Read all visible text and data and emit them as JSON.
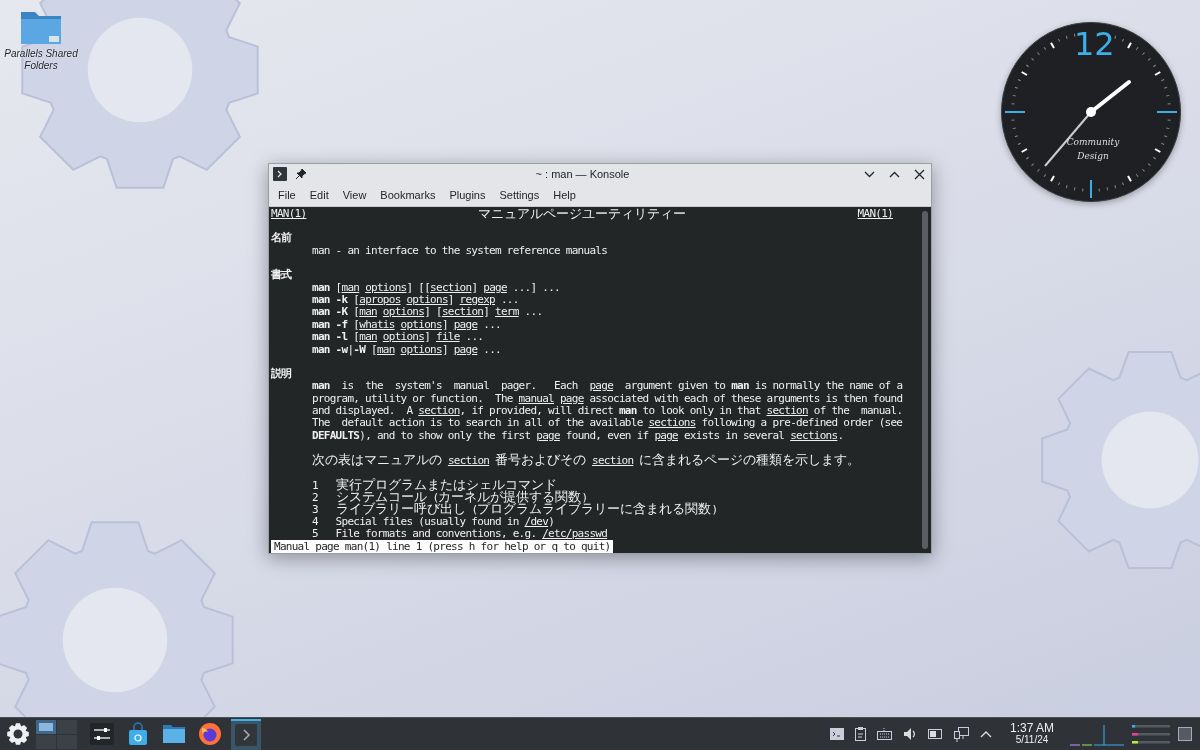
{
  "desktop": {
    "icons": [
      {
        "label": "Parallels Shared Folders"
      }
    ],
    "clock_widget": {
      "numeral": "12",
      "brand_lines": [
        "Community",
        "Design"
      ]
    }
  },
  "window": {
    "title": "~ : man — Konsole",
    "menu": [
      "File",
      "Edit",
      "View",
      "Bookmarks",
      "Plugins",
      "Settings",
      "Help"
    ]
  },
  "terminal": {
    "header": {
      "left": "MAN(1)",
      "center": "マニュアルページユーティリティー",
      "right": "MAN(1)"
    },
    "sections": [
      {
        "heading": "名前",
        "blocks": [
          [
            [
              {
                "text": "man - an interface to the system reference manuals",
                "bold": false,
                "underlined": false
              }
            ]
          ]
        ]
      },
      {
        "heading": "書式",
        "blocks": [
          [
            [
              {
                "text": "man",
                "bold": true,
                "underlined": false
              },
              {
                "text": " [",
                "bold": false,
                "underlined": false
              },
              {
                "text": "man",
                "bold": false,
                "underlined": true
              },
              {
                "text": " options",
                "bold": false,
                "underlined": true
              },
              {
                "text": "] [[",
                "bold": false,
                "underlined": false
              },
              {
                "text": "section",
                "bold": false,
                "underlined": true
              },
              {
                "text": "] ",
                "bold": false,
                "underlined": false
              },
              {
                "text": "page",
                "bold": false,
                "underlined": true
              },
              {
                "text": " ...] ...",
                "bold": false,
                "underlined": false
              }
            ],
            [
              {
                "text": "man -k",
                "bold": true,
                "underlined": false
              },
              {
                "text": " [",
                "bold": false,
                "underlined": false
              },
              {
                "text": "apropos",
                "bold": false,
                "underlined": true
              },
              {
                "text": " options",
                "bold": false,
                "underlined": true
              },
              {
                "text": "] ",
                "bold": false,
                "underlined": false
              },
              {
                "text": "regexp",
                "bold": false,
                "underlined": true
              },
              {
                "text": " ...",
                "bold": false,
                "underlined": false
              }
            ],
            [
              {
                "text": "man -K",
                "bold": true,
                "underlined": false
              },
              {
                "text": " [",
                "bold": false,
                "underlined": false
              },
              {
                "text": "man",
                "bold": false,
                "underlined": true
              },
              {
                "text": " options",
                "bold": false,
                "underlined": true
              },
              {
                "text": "] [",
                "bold": false,
                "underlined": false
              },
              {
                "text": "section",
                "bold": false,
                "underlined": true
              },
              {
                "text": "] ",
                "bold": false,
                "underlined": false
              },
              {
                "text": "term",
                "bold": false,
                "underlined": true
              },
              {
                "text": " ...",
                "bold": false,
                "underlined": false
              }
            ],
            [
              {
                "text": "man -f",
                "bold": true,
                "underlined": false
              },
              {
                "text": " [",
                "bold": false,
                "underlined": false
              },
              {
                "text": "whatis",
                "bold": false,
                "underlined": true
              },
              {
                "text": " options",
                "bold": false,
                "underlined": true
              },
              {
                "text": "] ",
                "bold": false,
                "underlined": false
              },
              {
                "text": "page",
                "bold": false,
                "underlined": true
              },
              {
                "text": " ...",
                "bold": false,
                "underlined": false
              }
            ],
            [
              {
                "text": "man -l",
                "bold": true,
                "underlined": false
              },
              {
                "text": " [",
                "bold": false,
                "underlined": false
              },
              {
                "text": "man",
                "bold": false,
                "underlined": true
              },
              {
                "text": " options",
                "bold": false,
                "underlined": true
              },
              {
                "text": "] ",
                "bold": false,
                "underlined": false
              },
              {
                "text": "file",
                "bold": false,
                "underlined": true
              },
              {
                "text": " ...",
                "bold": false,
                "underlined": false
              }
            ],
            [
              {
                "text": "man -w",
                "bold": true,
                "underlined": false
              },
              {
                "text": "|",
                "bold": false,
                "underlined": false
              },
              {
                "text": "-W",
                "bold": true,
                "underlined": false
              },
              {
                "text": " [",
                "bold": false,
                "underlined": false
              },
              {
                "text": "man",
                "bold": false,
                "underlined": true
              },
              {
                "text": " options",
                "bold": false,
                "underlined": true
              },
              {
                "text": "] ",
                "bold": false,
                "underlined": false
              },
              {
                "text": "page",
                "bold": false,
                "underlined": true
              },
              {
                "text": " ...",
                "bold": false,
                "underlined": false
              }
            ]
          ]
        ]
      },
      {
        "heading": "説明",
        "blocks": [
          [
            [
              {
                "text": "man",
                "bold": true,
                "underlined": false
              },
              {
                "text": "  is  the  system's  manual  pager.   Each  ",
                "bold": false,
                "underlined": false
              },
              {
                "text": "page",
                "bold": false,
                "underlined": true
              },
              {
                "text": "  argument given to ",
                "bold": false,
                "underlined": false
              },
              {
                "text": "man",
                "bold": true,
                "underlined": false
              },
              {
                "text": " is normally the name of a",
                "bold": false,
                "underlined": false
              }
            ],
            [
              {
                "text": "program, utility or function.  The ",
                "bold": false,
                "underlined": false
              },
              {
                "text": "manual",
                "bold": false,
                "underlined": true
              },
              {
                "text": " page",
                "bold": false,
                "underlined": true
              },
              {
                "text": " associated with each of these arguments is then found",
                "bold": false,
                "underlined": false
              }
            ],
            [
              {
                "text": "and displayed.  A ",
                "bold": false,
                "underlined": false
              },
              {
                "text": "section",
                "bold": false,
                "underlined": true
              },
              {
                "text": ", if provided, will direct ",
                "bold": false,
                "underlined": false
              },
              {
                "text": "man",
                "bold": true,
                "underlined": false
              },
              {
                "text": " to look only in that ",
                "bold": false,
                "underlined": false
              },
              {
                "text": "section",
                "bold": false,
                "underlined": true
              },
              {
                "text": " of the  manual.",
                "bold": false,
                "underlined": false
              }
            ],
            [
              {
                "text": "The  default action is to search in all of the available ",
                "bold": false,
                "underlined": false
              },
              {
                "text": "sections",
                "bold": false,
                "underlined": true
              },
              {
                "text": " following a pre-defined order (see",
                "bold": false,
                "underlined": false
              }
            ],
            [
              {
                "text": "DEFAULTS",
                "bold": true,
                "underlined": false
              },
              {
                "text": "), and to show only the first ",
                "bold": false,
                "underlined": false
              },
              {
                "text": "page",
                "bold": false,
                "underlined": true
              },
              {
                "text": " found, even if ",
                "bold": false,
                "underlined": false
              },
              {
                "text": "page",
                "bold": false,
                "underlined": true
              },
              {
                "text": " exists in several ",
                "bold": false,
                "underlined": false
              },
              {
                "text": "sections",
                "bold": false,
                "underlined": true
              },
              {
                "text": ".",
                "bold": false,
                "underlined": false
              }
            ]
          ],
          [
            [
              {
                "text": "次の表はマニュアルの ",
                "bold": false,
                "underlined": false
              },
              {
                "text": "section",
                "bold": false,
                "underlined": true
              },
              {
                "text": " 番号およびその ",
                "bold": false,
                "underlined": false
              },
              {
                "text": "section",
                "bold": false,
                "underlined": true
              },
              {
                "text": " に含まれるページの種類を示します。",
                "bold": false,
                "underlined": false
              }
            ]
          ],
          [
            [
              {
                "text": "1   実行プログラムまたはシェルコマンド",
                "bold": false,
                "underlined": false
              }
            ],
            [
              {
                "text": "2   システムコール (カーネルが提供する関数)",
                "bold": false,
                "underlined": false
              }
            ],
            [
              {
                "text": "3   ライブラリー呼び出し (プログラムライブラリーに含まれる関数)",
                "bold": false,
                "underlined": false
              }
            ],
            [
              {
                "text": "4   Special files (usually found in ",
                "bold": false,
                "underlined": false
              },
              {
                "text": "/dev",
                "bold": false,
                "underlined": true
              },
              {
                "text": ")",
                "bold": false,
                "underlined": false
              }
            ],
            [
              {
                "text": "5   File formats and conventions, e.g. ",
                "bold": false,
                "underlined": false
              },
              {
                "text": "/etc/passwd",
                "bold": false,
                "underlined": true
              }
            ]
          ]
        ]
      }
    ],
    "status_line": "Manual page man(1) line 1 (press h for help or q to quit)"
  },
  "taskbar": {
    "pager": [
      {
        "selected": true
      },
      {
        "selected": false
      },
      {
        "selected": false
      },
      {
        "selected": false
      }
    ],
    "tasks": [
      {
        "kind": "settings",
        "selected": false
      },
      {
        "kind": "store",
        "selected": false
      },
      {
        "kind": "folder",
        "selected": false
      },
      {
        "kind": "browser",
        "selected": false
      },
      {
        "kind": "terminal",
        "selected": true
      }
    ],
    "tray": [
      {
        "kind": "terminal"
      },
      {
        "kind": "clipboard"
      },
      {
        "kind": "keyboard"
      },
      {
        "kind": "volume"
      },
      {
        "kind": "battery"
      },
      {
        "kind": "network"
      },
      {
        "kind": "expand"
      }
    ],
    "time": "1:37 AM",
    "date": "5/11/24"
  }
}
